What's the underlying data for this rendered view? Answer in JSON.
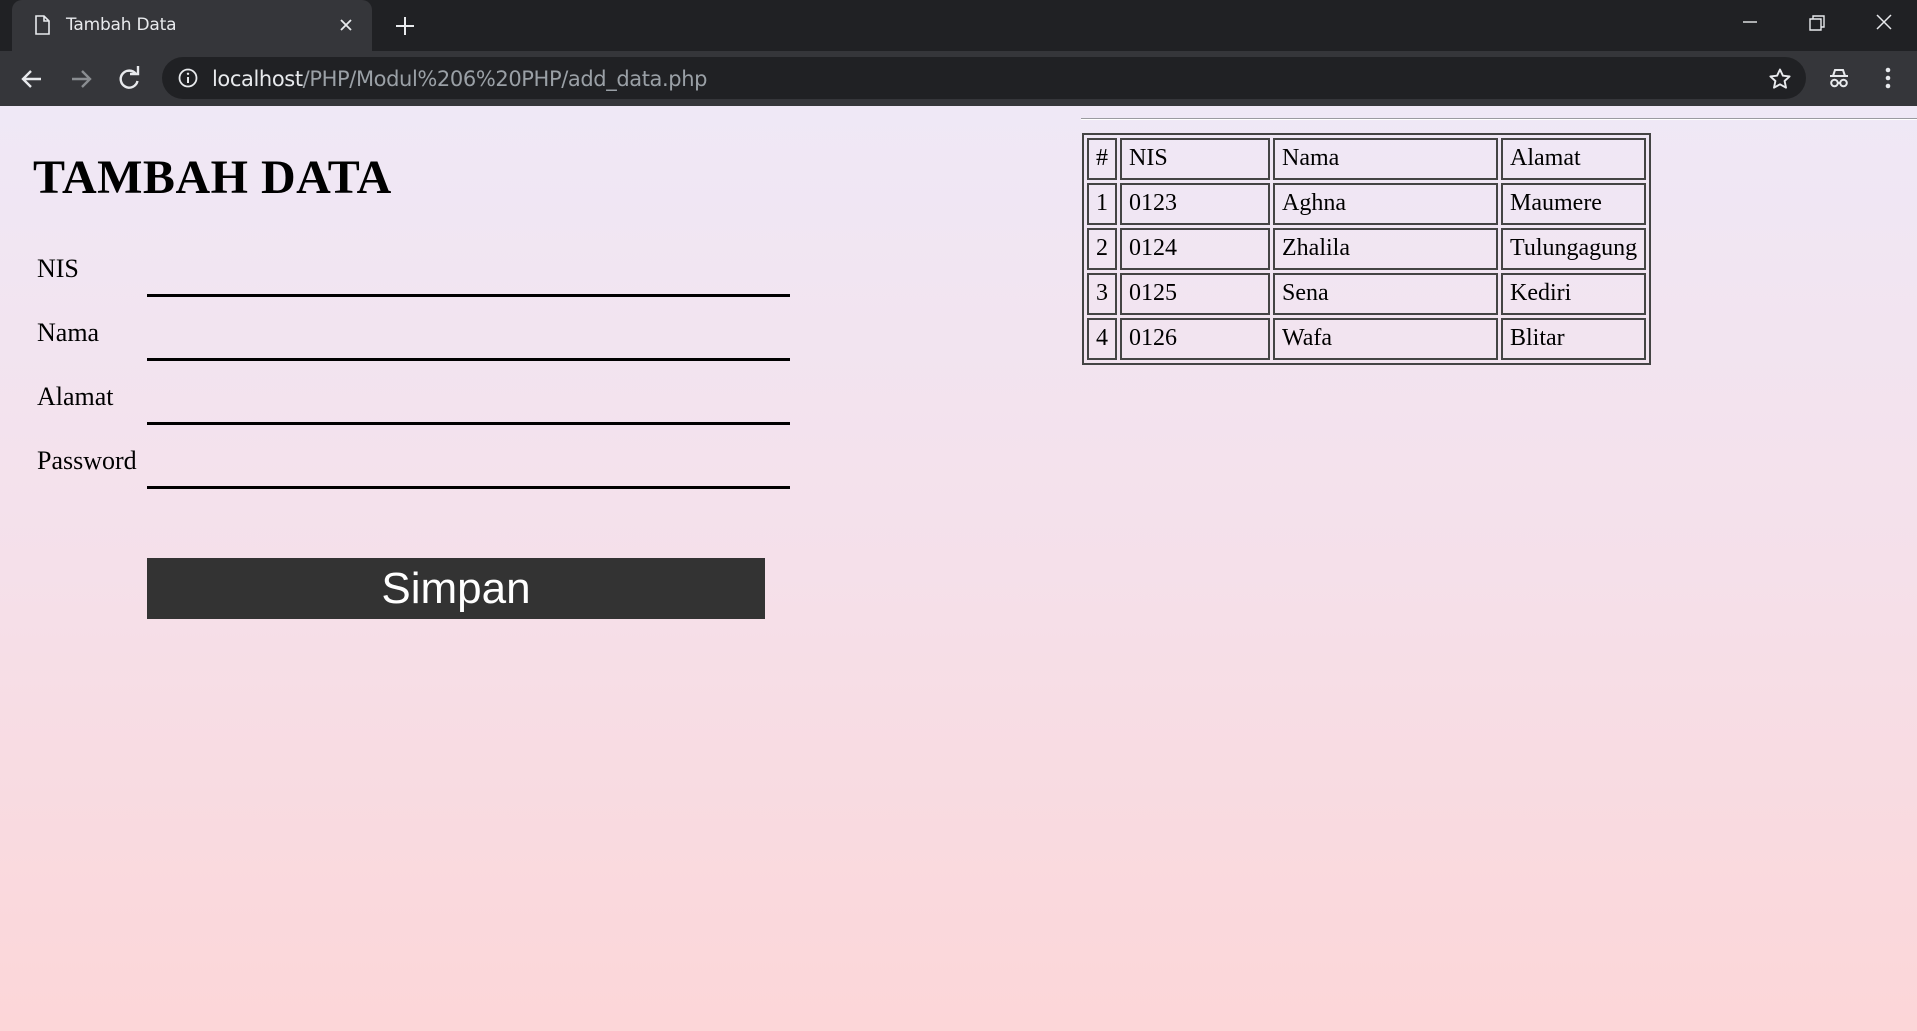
{
  "browser": {
    "tab_title": "Tambah Data",
    "url_host": "localhost",
    "url_path": "/PHP/Modul%206%20PHP/add_data.php",
    "icons": [
      "page-icon",
      "close-icon",
      "plus-icon",
      "minimize-icon",
      "restore-icon",
      "window-close-icon",
      "back-icon",
      "forward-icon",
      "reload-icon",
      "info-icon",
      "star-icon",
      "incognito-icon",
      "kebab-menu-icon"
    ]
  },
  "form": {
    "title": "TAMBAH DATA",
    "fields": [
      {
        "label": "NIS",
        "value": ""
      },
      {
        "label": "Nama",
        "value": ""
      },
      {
        "label": "Alamat",
        "value": ""
      },
      {
        "label": "Password",
        "value": ""
      }
    ],
    "submit_label": "Simpan"
  },
  "table": {
    "headers": [
      "#",
      "NIS",
      "Nama",
      "Alamat"
    ],
    "rows": [
      [
        "1",
        "0123",
        "Aghna",
        "Maumere"
      ],
      [
        "2",
        "0124",
        "Zhalila",
        "Tulungagung"
      ],
      [
        "3",
        "0125",
        "Sena",
        "Kediri"
      ],
      [
        "4",
        "0126",
        "Wafa",
        "Blitar"
      ]
    ]
  },
  "colors": {
    "chrome_dark": "#202124",
    "chrome_tab": "#35363a",
    "button_bg": "#333333",
    "page_top": "#efe8f6",
    "page_bottom": "#fcd6d8"
  }
}
